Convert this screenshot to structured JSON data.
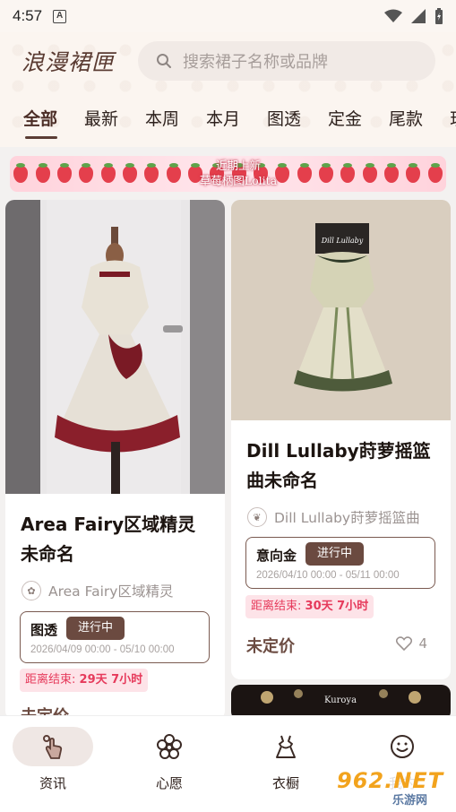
{
  "status_bar": {
    "time": "4:57"
  },
  "header": {
    "logo": "浪漫裙匣",
    "search_placeholder": "搜索裙子名称或品牌"
  },
  "tabs": [
    "全部",
    "最新",
    "本周",
    "本月",
    "图透",
    "定金",
    "尾款",
    "现"
  ],
  "active_tab": 0,
  "banner": {
    "line1": "近期上新",
    "line2": "草莓柄图Lolita"
  },
  "cards": [
    {
      "title": "Area Fairy区域精灵未命名",
      "brand": "Area Fairy区域精灵",
      "type": "图透",
      "status": "进行中",
      "dates": "2026/04/09 00:00 - 05/10 00:00",
      "countdown_prefix": "距离结束:",
      "countdown": "29天 7小时",
      "price": "未定价"
    },
    {
      "title": "Dill Lullaby莳萝摇篮曲未命名",
      "brand": "Dill Lullaby莳萝摇篮曲",
      "type": "意向金",
      "status": "进行中",
      "dates": "2026/04/10 00:00 - 05/11 00:00",
      "countdown_prefix": "距离结束:",
      "countdown": "30天 7小时",
      "price": "未定价",
      "likes": "4",
      "photo_label": "Dill Lullaby"
    },
    {
      "photo_label": "Kuroya"
    }
  ],
  "bottom_nav": [
    {
      "label": "资讯",
      "icon": "hand-tap-icon"
    },
    {
      "label": "心愿",
      "icon": "flower-icon"
    },
    {
      "label": "衣橱",
      "icon": "dress-icon"
    },
    {
      "label": "我的",
      "icon": "smile-icon"
    }
  ],
  "watermark": {
    "big": "962.NET",
    "small": "乐游网"
  },
  "colors": {
    "accent": "#6b4a40",
    "countdown": "#e63a5b",
    "countdown_bg": "#fde3e8"
  }
}
